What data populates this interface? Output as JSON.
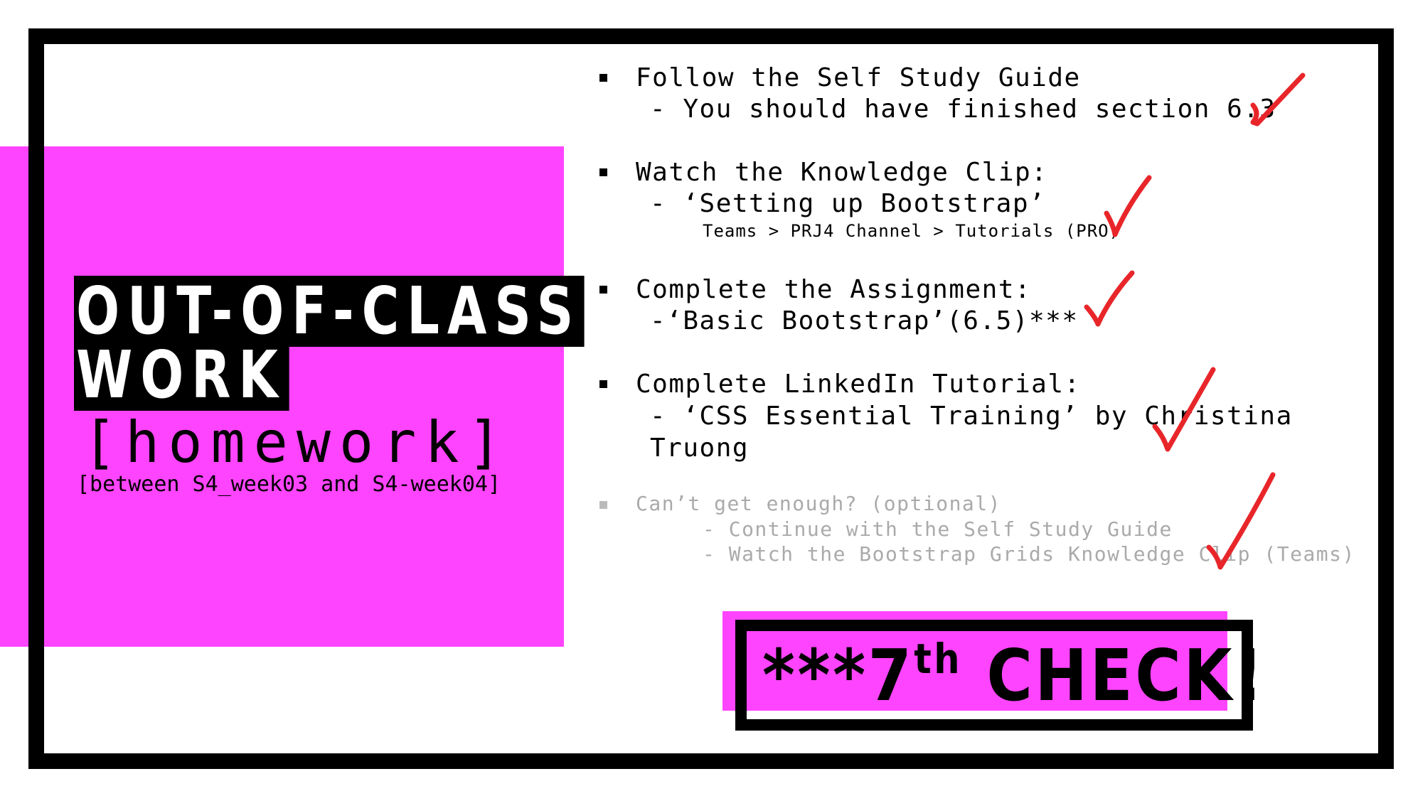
{
  "title": {
    "line1": "OUT-OF-CLASS",
    "line2": "WORK",
    "homework": "[homework]",
    "between": "[between S4_week03 and S4-week04]"
  },
  "items": [
    {
      "heading": "Follow the Self Study Guide",
      "sub": "-  You should have finished section 6.3"
    },
    {
      "heading": "Watch the Knowledge Clip:",
      "sub": "- ‘Setting up Bootstrap’",
      "path": "Teams > PRJ4 Channel > Tutorials (PRO)"
    },
    {
      "heading": "Complete the Assignment:",
      "sub": "-‘Basic Bootstrap’(6.5)***"
    },
    {
      "heading": "Complete LinkedIn Tutorial:",
      "sub": "- ‘CSS Essential Training’ by Christina",
      "sub2": "Truong"
    }
  ],
  "optional": {
    "heading": "Can’t get enough? (optional)",
    "line1": "- Continue with the Self Study Guide",
    "line2": "- Watch the Bootstrap Grids Knowledge Clip (Teams)"
  },
  "badge": {
    "prefix": "***7",
    "sup": "th",
    "suffix": " CHECK!"
  },
  "colors": {
    "accent": "#ff44ff",
    "check": "#e8262a",
    "frame": "#000000"
  }
}
